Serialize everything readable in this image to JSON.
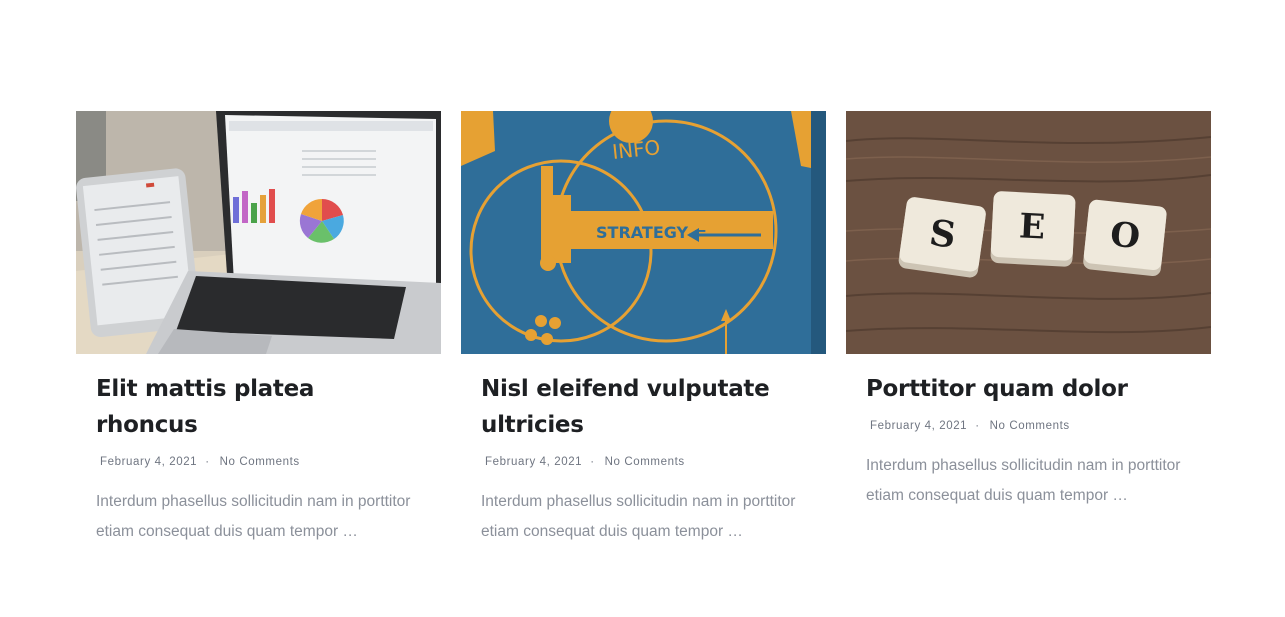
{
  "posts": [
    {
      "title": "Elit mattis platea rhoncus",
      "date": "February 4, 2021",
      "separator": "·",
      "comments": "No Comments",
      "excerpt": "Interdum phasellus sollicitudin nam in porttitor etiam consequat duis quam tempor …",
      "image": "laptop-tablet-charts"
    },
    {
      "title": "Nisl eleifend vulputate ultricies",
      "date": "February 4, 2021",
      "separator": "·",
      "comments": "No Comments",
      "excerpt": "Interdum phasellus sollicitudin nam in porttitor etiam consequat duis quam tempor …",
      "image": "strategy-poster",
      "image_text": {
        "info": "INFO",
        "strategy": "STRATEGY ="
      }
    },
    {
      "title": "Porttitor quam dolor",
      "date": "February 4, 2021",
      "separator": "·",
      "comments": "No Comments",
      "excerpt": "Interdum phasellus sollicitudin nam in porttitor etiam consequat duis quam tempor …",
      "image": "seo-scrabble-tiles",
      "image_text": {
        "t1": "S",
        "t2": "E",
        "t3": "O"
      }
    }
  ],
  "colors": {
    "title": "#1e2023",
    "meta": "#6f7581",
    "excerpt": "#8b909a",
    "poster_blue": "#2f6e99",
    "poster_orange": "#e6a133"
  }
}
